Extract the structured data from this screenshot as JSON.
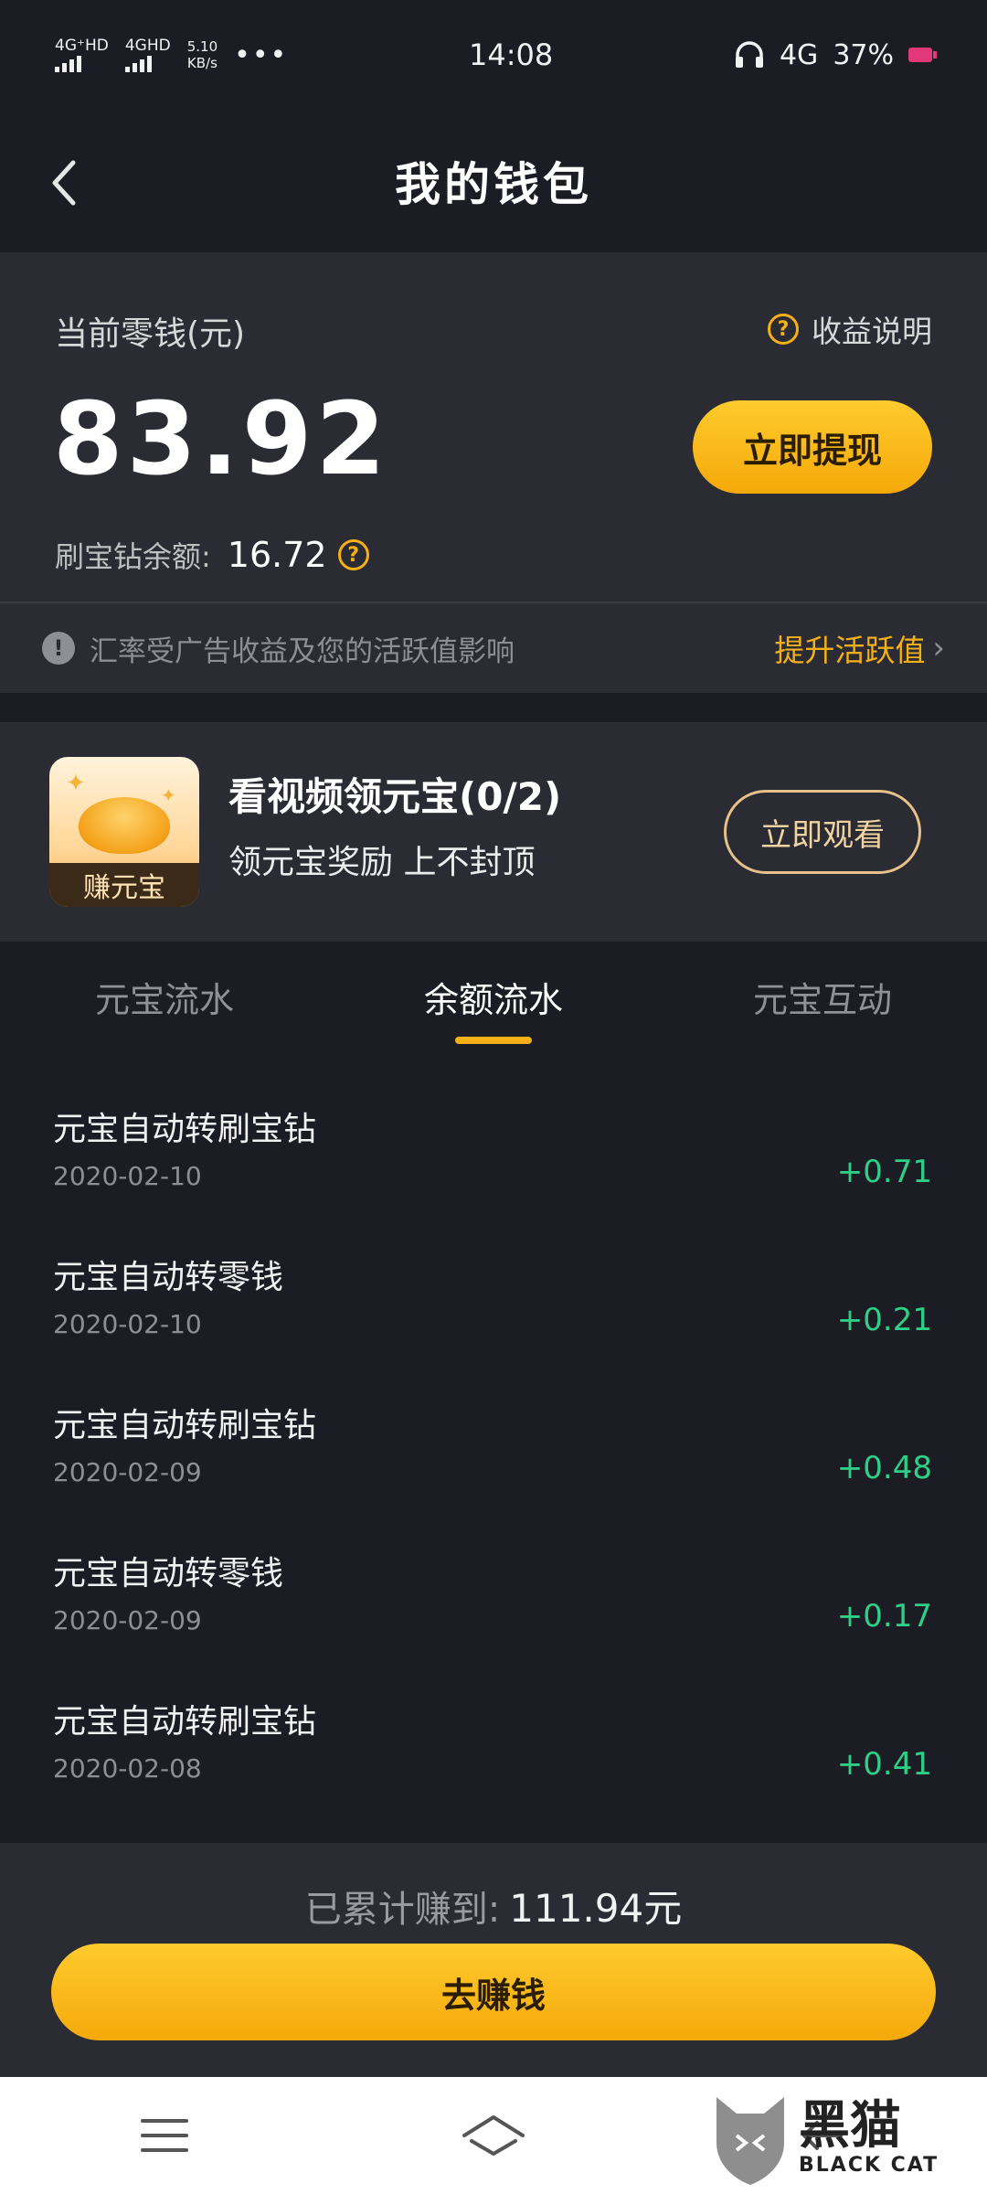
{
  "status_bar": {
    "net1": "4G⁺HD",
    "net2": "4GHD",
    "speed_value": "5.10",
    "speed_unit": "KB/s",
    "more": "•••",
    "time": "14:08",
    "net3": "4G",
    "battery": "37%"
  },
  "header": {
    "title": "我的钱包"
  },
  "balance": {
    "label": "当前零钱(元)",
    "help_label": "收益说明",
    "amount": "83.92",
    "withdraw_label": "立即提现",
    "diamond_label": "刷宝钻余额:",
    "diamond_value": "16.72",
    "notice": "汇率受广告收益及您的活跃值影响",
    "boost_label": "提升活跃值"
  },
  "promo": {
    "icon_label": "赚元宝",
    "title": "看视频领元宝(0/2)",
    "subtitle": "领元宝奖励 上不封顶",
    "button_label": "立即观看"
  },
  "tabs": [
    {
      "label": "元宝流水",
      "active": false
    },
    {
      "label": "余额流水",
      "active": true
    },
    {
      "label": "元宝互动",
      "active": false
    }
  ],
  "transactions": [
    {
      "title": "元宝自动转刷宝钻",
      "date": "2020-02-10",
      "amount": "+0.71"
    },
    {
      "title": "元宝自动转零钱",
      "date": "2020-02-10",
      "amount": "+0.21"
    },
    {
      "title": "元宝自动转刷宝钻",
      "date": "2020-02-09",
      "amount": "+0.48"
    },
    {
      "title": "元宝自动转零钱",
      "date": "2020-02-09",
      "amount": "+0.17"
    },
    {
      "title": "元宝自动转刷宝钻",
      "date": "2020-02-08",
      "amount": "+0.41"
    }
  ],
  "footer": {
    "total_label": "已累计赚到:",
    "total_value": "111.94元",
    "earn_label": "去赚钱"
  },
  "watermark": {
    "cn": "黑猫",
    "en": "BLACK CAT"
  },
  "colors": {
    "background": "#1c1d24",
    "card": "#2a2b33",
    "accent": "#f5b017",
    "positive": "#2ecf86"
  }
}
